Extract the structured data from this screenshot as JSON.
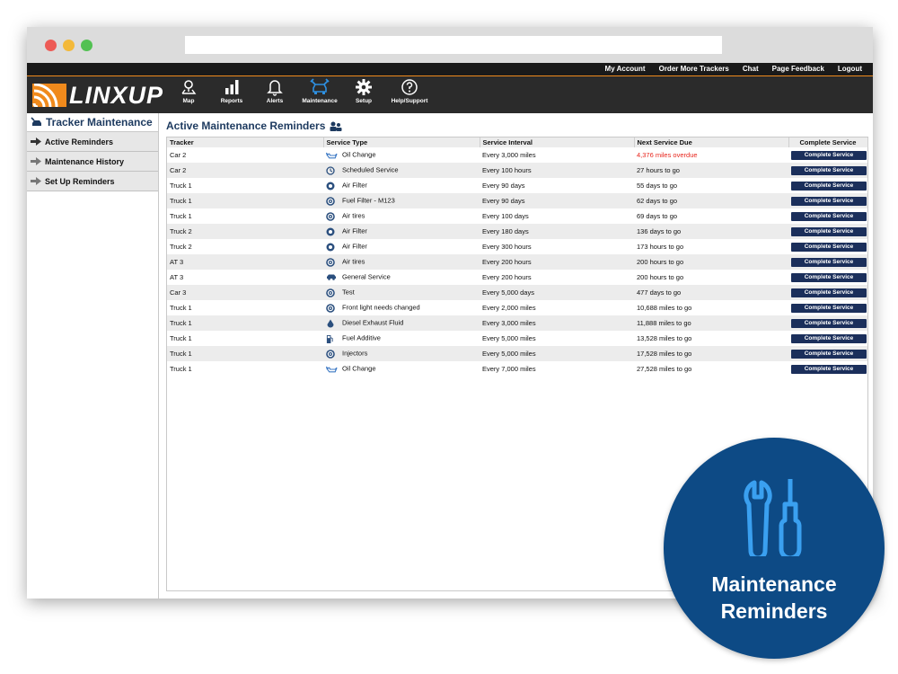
{
  "top_links": [
    "My Account",
    "Order More Trackers",
    "Chat",
    "Page Feedback",
    "Logout"
  ],
  "logo": "LINXUP",
  "nav": [
    {
      "label": "Map",
      "icon": "map-pin-icon"
    },
    {
      "label": "Reports",
      "icon": "bar-chart-icon"
    },
    {
      "label": "Alerts",
      "icon": "bell-icon"
    },
    {
      "label": "Maintenance",
      "icon": "car-wrench-icon",
      "active": true
    },
    {
      "label": "Setup",
      "icon": "gear-icon"
    },
    {
      "label": "Help/Support",
      "icon": "question-icon"
    }
  ],
  "sidebar": {
    "title": "Tracker Maintenance",
    "items": [
      "Active Reminders",
      "Maintenance History",
      "Set Up Reminders"
    ]
  },
  "main": {
    "title": "Active Maintenance Reminders",
    "columns": [
      "Tracker",
      "Service Type",
      "Service Interval",
      "Next Service Due",
      "Complete Service"
    ],
    "button_label": "Complete Service",
    "rows": [
      {
        "tracker": "Car 2",
        "service": "Oil Change",
        "icon": "oil-can-icon",
        "interval": "Every 3,000 miles",
        "due": "4,376 miles overdue",
        "overdue": true
      },
      {
        "tracker": "Car 2",
        "service": "Scheduled Service",
        "icon": "clock-icon",
        "interval": "Every 100 hours",
        "due": "27 hours to go"
      },
      {
        "tracker": "Truck 1",
        "service": "Air Filter",
        "icon": "filter-icon",
        "interval": "Every 90 days",
        "due": "55 days to go"
      },
      {
        "tracker": "Truck 1",
        "service": "Fuel Filter - M123",
        "icon": "gear-badge-icon",
        "interval": "Every 90 days",
        "due": "62 days to go"
      },
      {
        "tracker": "Truck 1",
        "service": "Air tires",
        "icon": "gear-badge-icon",
        "interval": "Every 100 days",
        "due": "69 days to go"
      },
      {
        "tracker": "Truck 2",
        "service": "Air Filter",
        "icon": "filter-icon",
        "interval": "Every 180 days",
        "due": "136 days to go"
      },
      {
        "tracker": "Truck 2",
        "service": "Air Filter",
        "icon": "filter-icon",
        "interval": "Every 300 hours",
        "due": "173 hours to go"
      },
      {
        "tracker": "AT 3",
        "service": "Air tires",
        "icon": "gear-badge-icon",
        "interval": "Every 200 hours",
        "due": "200 hours to go"
      },
      {
        "tracker": "AT 3",
        "service": "General Service",
        "icon": "car-icon",
        "interval": "Every 200 hours",
        "due": "200 hours to go"
      },
      {
        "tracker": "Car 3",
        "service": "Test",
        "icon": "gear-badge-icon",
        "interval": "Every 5,000 days",
        "due": "477 days to go"
      },
      {
        "tracker": "Truck 1",
        "service": "Front light needs changed",
        "icon": "gear-badge-icon",
        "interval": "Every 2,000 miles",
        "due": "10,688 miles to go"
      },
      {
        "tracker": "Truck 1",
        "service": "Diesel Exhaust Fluid",
        "icon": "drop-icon",
        "interval": "Every 3,000 miles",
        "due": "11,888 miles to go"
      },
      {
        "tracker": "Truck 1",
        "service": "Fuel Additive",
        "icon": "fuel-pump-icon",
        "interval": "Every 5,000 miles",
        "due": "13,528 miles to go"
      },
      {
        "tracker": "Truck 1",
        "service": "Injectors",
        "icon": "gear-badge-icon",
        "interval": "Every 5,000 miles",
        "due": "17,528 miles to go"
      },
      {
        "tracker": "Truck 1",
        "service": "Oil Change",
        "icon": "oil-can-icon",
        "interval": "Every 7,000 miles",
        "due": "27,528 miles to go"
      }
    ]
  },
  "badge": {
    "line1": "Maintenance",
    "line2": "Reminders"
  },
  "colors": {
    "accent": "#f08a1c",
    "navy": "#1d3a5f",
    "button": "#1b2f5b",
    "overdue": "#e8261d",
    "badge": "#0d4a85",
    "icon_blue": "#2e8fe0"
  }
}
